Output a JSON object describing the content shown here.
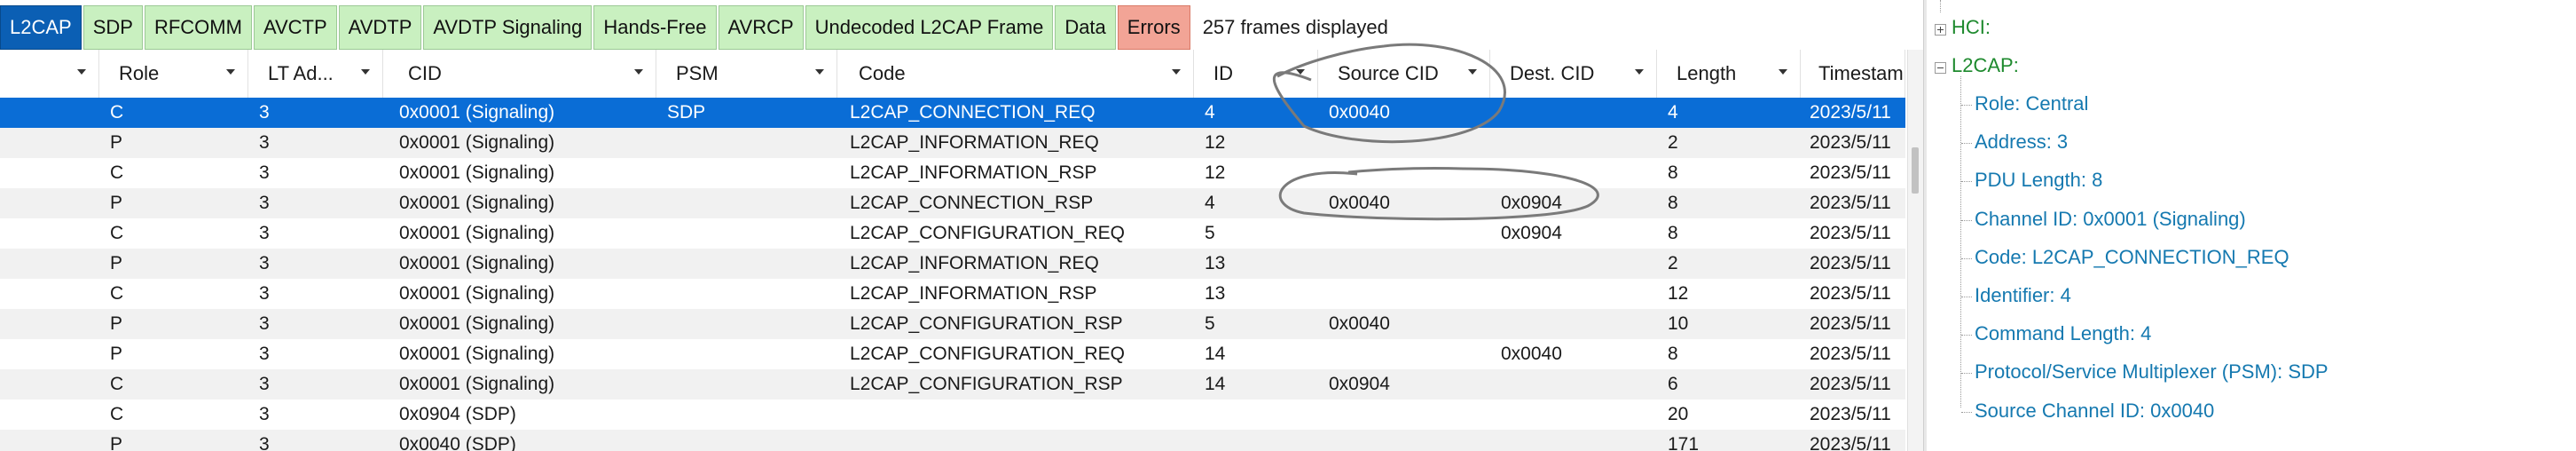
{
  "tabs": [
    {
      "label": "L2CAP",
      "active": true
    },
    {
      "label": "SDP"
    },
    {
      "label": "RFCOMM"
    },
    {
      "label": "AVCTP"
    },
    {
      "label": "AVDTP"
    },
    {
      "label": "AVDTP Signaling"
    },
    {
      "label": "Hands-Free"
    },
    {
      "label": "AVRCP"
    },
    {
      "label": "Undecoded L2CAP Frame"
    },
    {
      "label": "Data"
    },
    {
      "label": "Errors",
      "error": true
    }
  ],
  "frames_displayed": "257 frames displayed",
  "columns": [
    {
      "key": "blank",
      "label": ""
    },
    {
      "key": "role",
      "label": "Role"
    },
    {
      "key": "lt",
      "label": "LT Ad..."
    },
    {
      "key": "cid",
      "label": "CID"
    },
    {
      "key": "psm",
      "label": "PSM"
    },
    {
      "key": "code",
      "label": "Code"
    },
    {
      "key": "id",
      "label": "ID"
    },
    {
      "key": "src",
      "label": "Source CID"
    },
    {
      "key": "dst",
      "label": "Dest. CID"
    },
    {
      "key": "len",
      "label": "Length"
    },
    {
      "key": "ts",
      "label": "Timestamp"
    }
  ],
  "rows": [
    {
      "role": "C",
      "lt": "3",
      "cid": "0x0001  (Signaling)",
      "psm": "SDP",
      "code": "L2CAP_CONNECTION_REQ",
      "id": "4",
      "src": "0x0040",
      "dst": "",
      "len": "4",
      "ts": "2023/5/11",
      "selected": true
    },
    {
      "role": "P",
      "lt": "3",
      "cid": "0x0001  (Signaling)",
      "psm": "",
      "code": "L2CAP_INFORMATION_REQ",
      "id": "12",
      "src": "",
      "dst": "",
      "len": "2",
      "ts": "2023/5/11"
    },
    {
      "role": "C",
      "lt": "3",
      "cid": "0x0001  (Signaling)",
      "psm": "",
      "code": "L2CAP_INFORMATION_RSP",
      "id": "12",
      "src": "",
      "dst": "",
      "len": "8",
      "ts": "2023/5/11"
    },
    {
      "role": "P",
      "lt": "3",
      "cid": "0x0001  (Signaling)",
      "psm": "",
      "code": "L2CAP_CONNECTION_RSP",
      "id": "4",
      "src": "0x0040",
      "dst": "0x0904",
      "len": "8",
      "ts": "2023/5/11"
    },
    {
      "role": "C",
      "lt": "3",
      "cid": "0x0001  (Signaling)",
      "psm": "",
      "code": "L2CAP_CONFIGURATION_REQ",
      "id": "5",
      "src": "",
      "dst": "0x0904",
      "len": "8",
      "ts": "2023/5/11"
    },
    {
      "role": "P",
      "lt": "3",
      "cid": "0x0001  (Signaling)",
      "psm": "",
      "code": "L2CAP_INFORMATION_REQ",
      "id": "13",
      "src": "",
      "dst": "",
      "len": "2",
      "ts": "2023/5/11"
    },
    {
      "role": "C",
      "lt": "3",
      "cid": "0x0001  (Signaling)",
      "psm": "",
      "code": "L2CAP_INFORMATION_RSP",
      "id": "13",
      "src": "",
      "dst": "",
      "len": "12",
      "ts": "2023/5/11"
    },
    {
      "role": "P",
      "lt": "3",
      "cid": "0x0001  (Signaling)",
      "psm": "",
      "code": "L2CAP_CONFIGURATION_RSP",
      "id": "5",
      "src": "0x0040",
      "dst": "",
      "len": "10",
      "ts": "2023/5/11"
    },
    {
      "role": "P",
      "lt": "3",
      "cid": "0x0001  (Signaling)",
      "psm": "",
      "code": "L2CAP_CONFIGURATION_REQ",
      "id": "14",
      "src": "",
      "dst": "0x0040",
      "len": "8",
      "ts": "2023/5/11"
    },
    {
      "role": "C",
      "lt": "3",
      "cid": "0x0001  (Signaling)",
      "psm": "",
      "code": "L2CAP_CONFIGURATION_RSP",
      "id": "14",
      "src": "0x0904",
      "dst": "",
      "len": "6",
      "ts": "2023/5/11"
    },
    {
      "role": "C",
      "lt": "3",
      "cid": "0x0904  (SDP)",
      "psm": "",
      "code": "",
      "id": "",
      "src": "",
      "dst": "",
      "len": "20",
      "ts": "2023/5/11"
    },
    {
      "role": "P",
      "lt": "3",
      "cid": "0x0040  (SDP)",
      "psm": "",
      "code": "",
      "id": "",
      "src": "",
      "dst": "",
      "len": "171",
      "ts": "2023/5/11"
    }
  ],
  "tree": {
    "hci_label": "HCI:",
    "l2cap_label": "L2CAP:",
    "fields": [
      "Role: Central",
      "Address: 3",
      "PDU Length: 8",
      "Channel ID: 0x0001  (Signaling)",
      "Code: L2CAP_CONNECTION_REQ",
      "Identifier: 4",
      "Command Length: 4",
      "Protocol/Service Multiplexer (PSM): SDP",
      "Source Channel ID: 0x0040"
    ]
  },
  "colors": {
    "tab_bg": "#c9f0c0",
    "tab_active": "#0b5fb4",
    "tab_error": "#f2a496",
    "selection": "#0a6dd6",
    "tree_level1": "#1e8a2e",
    "tree_level2": "#1579b0"
  },
  "icons": [
    "caret-down-icon",
    "tree-expand-plus-icon",
    "tree-collapse-minus-icon"
  ]
}
